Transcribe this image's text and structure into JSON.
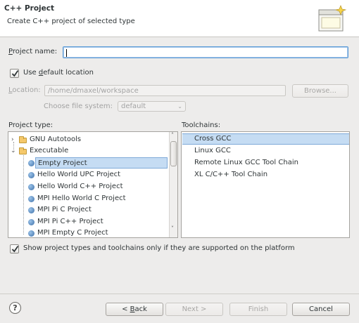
{
  "header": {
    "title": "C++ Project",
    "subtitle": "Create C++ project of selected type"
  },
  "project_name": {
    "label_prefix": "",
    "label_mnemonic": "P",
    "label_rest": "roject name:",
    "value": ""
  },
  "default_location": {
    "label_prefix": "Use ",
    "label_mnemonic": "d",
    "label_rest": "efault location",
    "checked": true
  },
  "location": {
    "label_mnemonic": "L",
    "label_rest": "ocation:",
    "value": "/home/dmaxel/workspace",
    "browse_label": "Browse..."
  },
  "file_system": {
    "label": "Choose file system:",
    "value": "default"
  },
  "project_type": {
    "label": "Project type:",
    "items": [
      {
        "label": "GNU Autotools",
        "kind": "folder",
        "expanded": false
      },
      {
        "label": "Executable",
        "kind": "folder",
        "expanded": true
      },
      {
        "label": "Empty Project",
        "kind": "leaf",
        "selected": true
      },
      {
        "label": "Hello World UPC Project",
        "kind": "leaf"
      },
      {
        "label": "Hello World C++ Project",
        "kind": "leaf"
      },
      {
        "label": "MPI Hello World C Project",
        "kind": "leaf"
      },
      {
        "label": "MPI Pi C Project",
        "kind": "leaf"
      },
      {
        "label": "MPI Pi C++ Project",
        "kind": "leaf"
      },
      {
        "label": "MPI Empty C Project",
        "kind": "leaf"
      }
    ]
  },
  "toolchains": {
    "label": "Toolchains:",
    "items": [
      {
        "label": "Cross GCC",
        "selected": true
      },
      {
        "label": "Linux GCC"
      },
      {
        "label": "Remote Linux GCC Tool Chain"
      },
      {
        "label": "XL C/C++ Tool Chain"
      }
    ]
  },
  "filter_checkbox": {
    "label": "Show project types and toolchains only if they are supported on the platform",
    "checked": true
  },
  "buttons": {
    "back_prefix": "< ",
    "back_mnemonic": "B",
    "back_rest": "ack",
    "next": "Next >",
    "finish": "Finish",
    "cancel": "Cancel",
    "help": "?"
  },
  "colors": {
    "selection": "#c5dcf3",
    "focus_border": "#5a9ad6"
  },
  "icons": [
    "wizard-banner-icon",
    "checkmark-icon",
    "folder-icon",
    "bullet-icon",
    "chevron-right-icon",
    "chevron-down-icon",
    "help-icon"
  ]
}
